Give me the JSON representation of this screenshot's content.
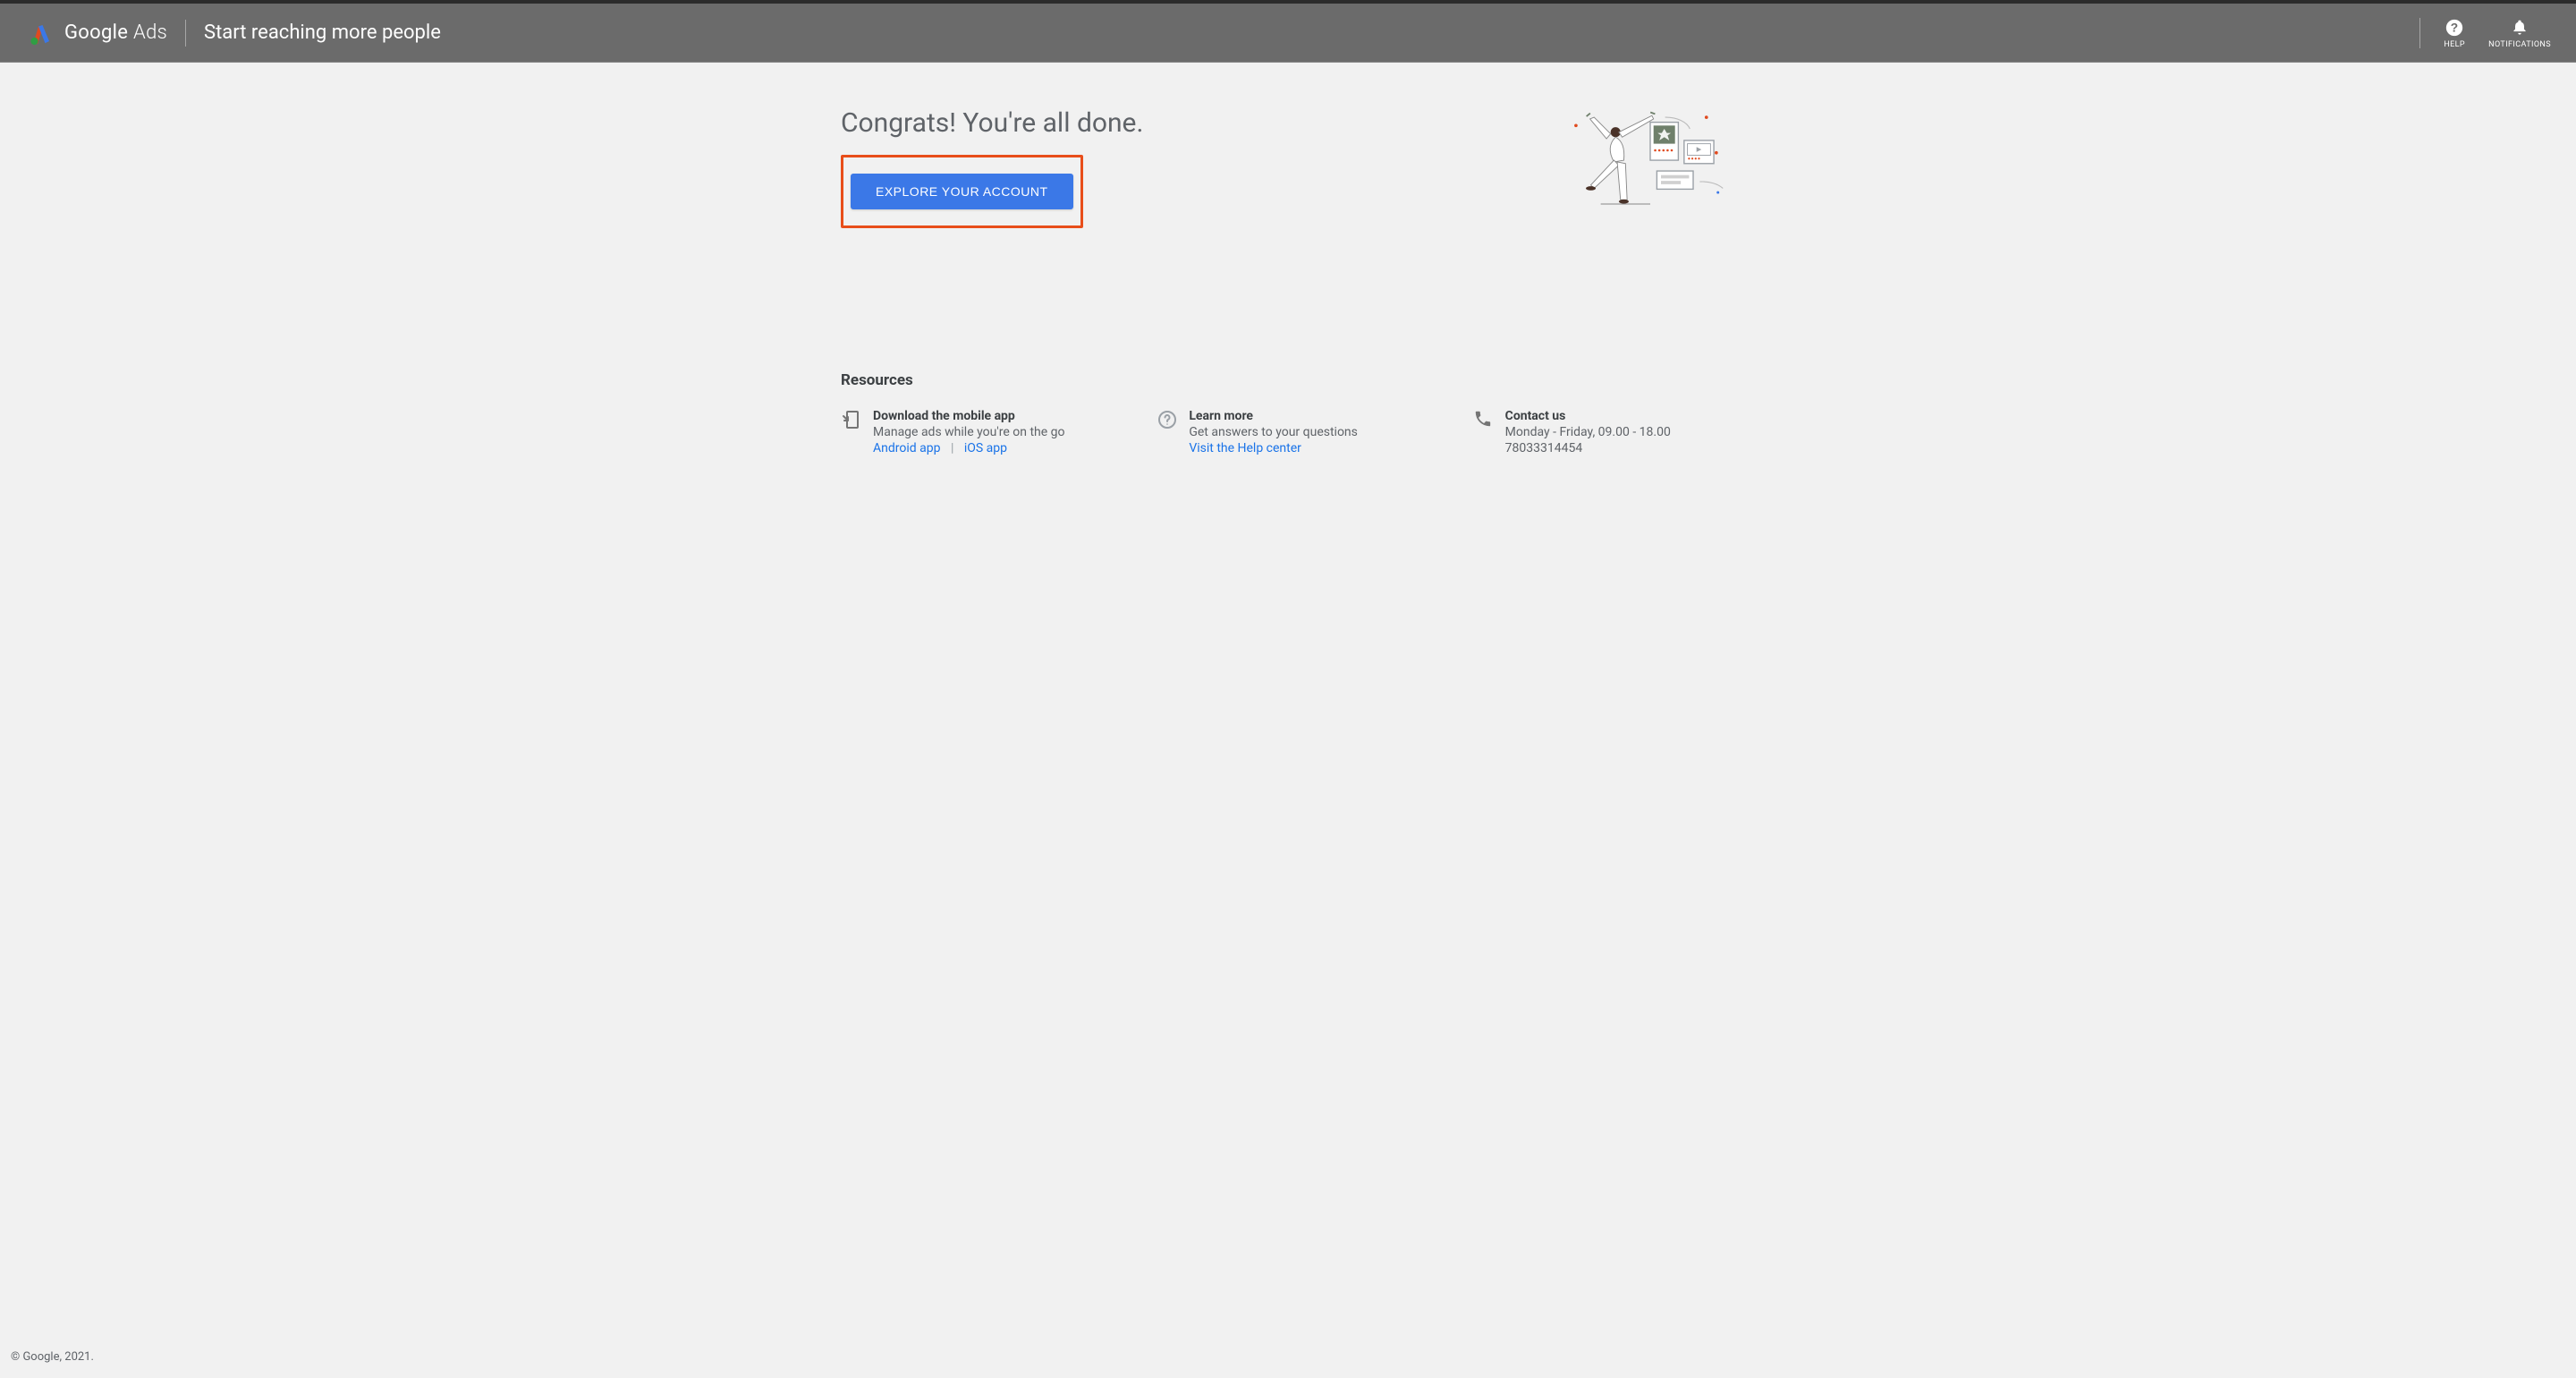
{
  "header": {
    "brand": "Google",
    "brand_suffix": "Ads",
    "subtitle": "Start reaching more people",
    "help_label": "HELP",
    "notifications_label": "NOTIFICATIONS"
  },
  "main": {
    "heading": "Congrats! You're all done.",
    "cta_label": "EXPLORE YOUR ACCOUNT"
  },
  "resources": {
    "title": "Resources",
    "items": [
      {
        "title": "Download the mobile app",
        "desc": "Manage ads while you're on the go",
        "link1": "Android app",
        "link2": "iOS app"
      },
      {
        "title": "Learn more",
        "desc": "Get answers to your questions",
        "link1": "Visit the Help center"
      },
      {
        "title": "Contact us",
        "desc": "Monday - Friday, 09.00 - 18.00",
        "extra": "78033314454"
      }
    ]
  },
  "footer": {
    "copyright": "© Google, 2021."
  }
}
